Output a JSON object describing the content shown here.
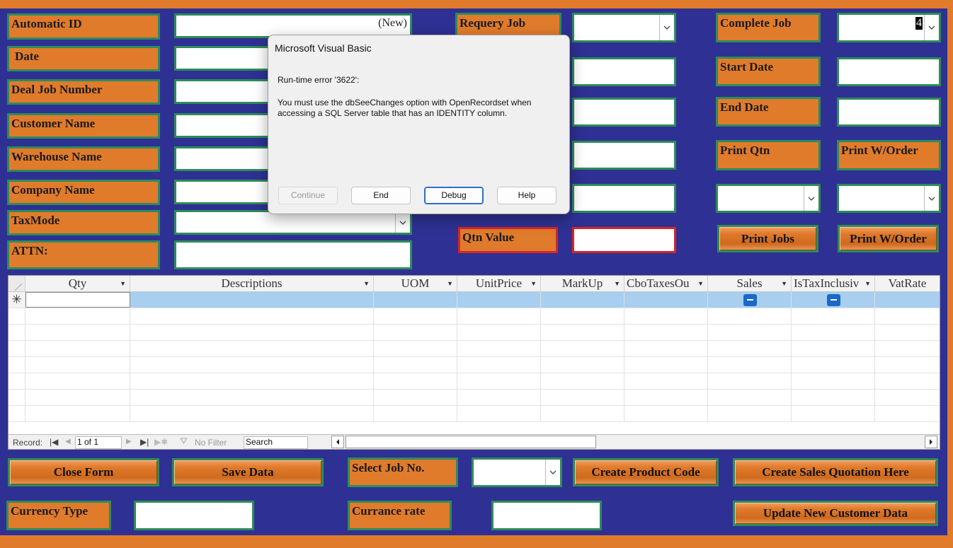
{
  "left_fields": [
    {
      "label": "Automatic ID",
      "value": "(New)"
    },
    {
      "label": "Date",
      "value": ""
    },
    {
      "label": "Deal Job Number",
      "value": ""
    },
    {
      "label": "Customer Name",
      "value": ""
    },
    {
      "label": "Warehouse Name",
      "value": ""
    },
    {
      "label": "Company Name",
      "value": ""
    },
    {
      "label": "TaxMode",
      "value": ""
    },
    {
      "label": "ATTN:",
      "value": ""
    }
  ],
  "middle": {
    "requery_job_label": "Requery Job",
    "qtn_value_label": "Qtn Value"
  },
  "right": {
    "complete_job_label": "Complete Job",
    "complete_job_value": "4",
    "start_date_label": "Start Date",
    "end_date_label": "End Date",
    "print_qtn_label": "Print Qtn",
    "print_worder_label": "Print W/Order",
    "print_jobs_button": "Print Jobs",
    "print_worder_button": "Print W/Order"
  },
  "grid": {
    "columns": [
      "Qty",
      "Descriptions",
      "UOM",
      "UnitPrice",
      "MarkUp",
      "CboTaxesOu",
      "Sales",
      "IsTaxInclusiv",
      "VatRate"
    ],
    "new_row_marker": "✳",
    "nav": {
      "record_label": "Record:",
      "position": "1 of 1",
      "filter_label": "No Filter",
      "search_label": "Search"
    }
  },
  "bottom": {
    "close_form": "Close Form",
    "save_data": "Save Data",
    "select_job_label": "Select Job No.",
    "create_product_code": "Create Product Code",
    "create_sales_quotation": "Create Sales Quotation Here",
    "currency_type_label": "Currency Type",
    "currance_rate_label": "Currance rate",
    "update_customer": "Update New Customer Data"
  },
  "dialog": {
    "title": "Microsoft Visual Basic",
    "error": "Run-time error '3622':",
    "message": "You must use the dbSeeChanges option with OpenRecordset when accessing a SQL Server table that has an IDENTITY column.",
    "buttons": {
      "continue": "Continue",
      "end": "End",
      "debug": "Debug",
      "help": "Help"
    }
  },
  "colors": {
    "form_background": "#2e3193",
    "frame_orange": "#e07b2c",
    "label_border_green": "#2e8b5a",
    "highlight_red": "#d42626",
    "grid_new_row": "#a8cef0"
  }
}
